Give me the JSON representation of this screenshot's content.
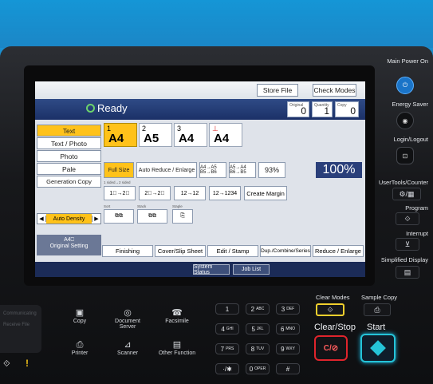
{
  "top": {
    "store_file": "Store File",
    "check_modes": "Check Modes"
  },
  "status": {
    "ready": "Ready",
    "original_label": "Original",
    "original_val": "0",
    "quantity_label": "Quantity",
    "quantity_val": "1",
    "copy_label": "Copy",
    "copy_val": "0"
  },
  "originals": [
    "Text",
    "Text / Photo",
    "Photo",
    "Pale",
    "Generation Copy"
  ],
  "paper": [
    {
      "num": "1",
      "size": "A4"
    },
    {
      "num": "2",
      "size": "A5"
    },
    {
      "num": "3",
      "size": "A4"
    },
    {
      "num": "",
      "size": "A4"
    }
  ],
  "reduce": {
    "full": "Full Size",
    "auto": "Auto Reduce / Enlarge",
    "a4a5": "A4→A5 B5→B6",
    "a5a4": "A5→A4 B6→B5",
    "p93": "93%",
    "p100": "100%"
  },
  "duplex_label": "1 sided→2 sided",
  "create_margin": "Create Margin",
  "sort_labels": {
    "sort": "Sort",
    "stack": "Stack",
    "staple": "Staple"
  },
  "auto_density": "Auto Density",
  "original_setting": "Original Setting",
  "tabs": [
    "Finishing",
    "Cover/Slip Sheet",
    "Edit / Stamp",
    "Dup./Combine/Series",
    "Reduce / Enlarge"
  ],
  "sysbar": {
    "system_status": "System Status",
    "job_list": "Job List"
  },
  "right": {
    "main_power": "Main Power On",
    "energy_saver": "Energy Saver",
    "login": "Login/Logout",
    "usertools": "UserTools/Counter",
    "program": "Program",
    "interrupt": "Interrupt",
    "simplified": "Simplified Display"
  },
  "left_side": {
    "communicating": "Communicating",
    "receive_file": "Receive File"
  },
  "functions": [
    {
      "label": "Copy",
      "glyph": "▣"
    },
    {
      "label": "Document Server",
      "glyph": "◎"
    },
    {
      "label": "Facsimile",
      "glyph": "☎"
    },
    {
      "label": "Printer",
      "glyph": "⎙"
    },
    {
      "label": "Scanner",
      "glyph": "⊿"
    },
    {
      "label": "Other Function",
      "glyph": "▤"
    }
  ],
  "keys": [
    [
      "1",
      ""
    ],
    [
      "2",
      "ABC"
    ],
    [
      "3",
      "DEF"
    ],
    [
      "4",
      "GHI"
    ],
    [
      "5",
      "JKL"
    ],
    [
      "6",
      "MNO"
    ],
    [
      "7",
      "PRS"
    ],
    [
      "8",
      "TUV"
    ],
    [
      "9",
      "WXY"
    ],
    [
      "·/✱",
      ""
    ],
    [
      "0",
      "OPER"
    ],
    [
      "#",
      ""
    ]
  ],
  "bottom": {
    "clear_modes": "Clear Modes",
    "sample_copy": "Sample Copy",
    "clear_stop": "Clear/Stop",
    "start": "Start",
    "clear_stop_glyph": "C/⊘"
  },
  "colors": {
    "accent_blue": "#1b8fd3",
    "start_green": "#25c4d8",
    "stop_red": "#e0242c",
    "clear_yellow": "#f2d02d"
  }
}
